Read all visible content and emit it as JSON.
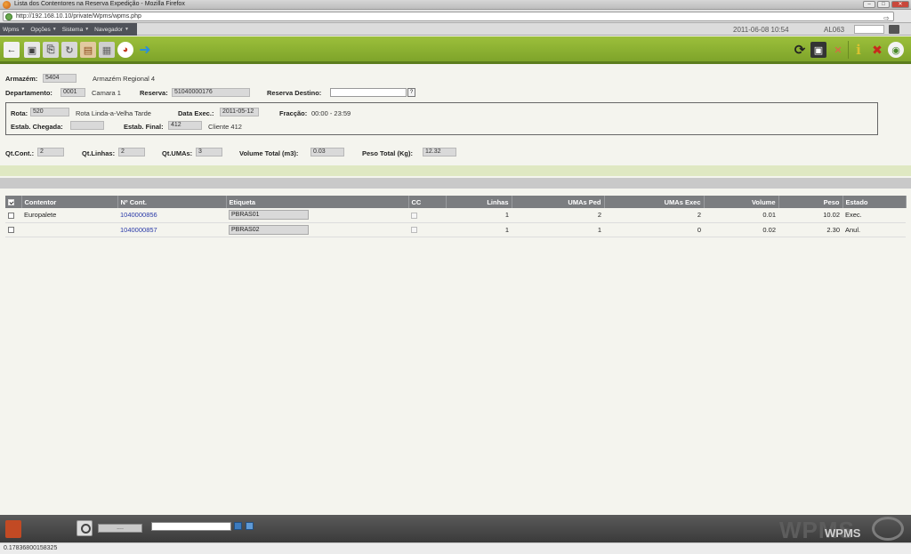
{
  "window": {
    "title": "Lista dos Contentores na Reserva Expedição - Mozilla Firefox"
  },
  "browser": {
    "url": "http://192.168.10.10/private/Wpms/wpms.php"
  },
  "menubar": {
    "menus": [
      {
        "label": "Wpms"
      },
      {
        "label": "Opções"
      },
      {
        "label": "Sistema"
      },
      {
        "label": "Navegador"
      }
    ],
    "datetime": "2011-06-08 10:54",
    "user": "AL063"
  },
  "header": {
    "armazem_label": "Armazém:",
    "armazem_code": "5404",
    "armazem_name": "Armazém Regional 4",
    "departamento_label": "Departamento:",
    "departamento_code": "0001",
    "departamento_name": "Camara 1",
    "reserva_label": "Reserva:",
    "reserva_value": "51040000176",
    "reserva_destino_label": "Reserva Destino:",
    "reserva_destino_value": "",
    "lookup_label": "?",
    "rota_label": "Rota:",
    "rota_code": "520",
    "rota_name": "Rota Linda-a-Velha Tarde",
    "data_exec_label": "Data Exec.:",
    "data_exec_value": "2011-05-12",
    "fraccao_label": "Fracção:",
    "fraccao_value": "00:00 - 23:59",
    "estab_chegada_label": "Estab. Chegada:",
    "estab_chegada_value": "",
    "estab_final_label": "Estab. Final:",
    "estab_final_code": "412",
    "estab_final_name": "Cliente 412"
  },
  "totals": {
    "qt_cont_label": "Qt.Cont.:",
    "qt_cont": "2",
    "qt_linhas_label": "Qt.Linhas:",
    "qt_linhas": "2",
    "qt_umas_label": "Qt.UMAs:",
    "qt_umas": "3",
    "volume_label": "Volume Total (m3):",
    "volume": "0.03",
    "peso_label": "Peso Total (Kg):",
    "peso": "12.32"
  },
  "table": {
    "columns": [
      "Contentor",
      "Nº Cont.",
      "Etiqueta",
      "CC",
      "Linhas",
      "UMAs Ped",
      "UMAs Exec",
      "Volume",
      "Peso",
      "Estado"
    ],
    "rows": [
      {
        "contentor": "Europalete",
        "num": "1040000856",
        "etiqueta": "PBRAS01",
        "linhas": "1",
        "umas_ped": "2",
        "umas_exec": "2",
        "volume": "0.01",
        "peso": "10.02",
        "estado": "Exec."
      },
      {
        "contentor": "",
        "num": "1040000857",
        "etiqueta": "PBRAS02",
        "linhas": "1",
        "umas_ped": "1",
        "umas_exec": "0",
        "volume": "0.02",
        "peso": "2.30",
        "estado": "Anul."
      }
    ]
  },
  "footer": {
    "more_label": "....",
    "logo": "WPMS",
    "logo_sub": "WPMS"
  },
  "status": {
    "text": "0.17836800158325"
  },
  "colors": {
    "toolbar_green": "#8db233",
    "header_gray": "#7b7d80",
    "link_blue": "#2a3aa8"
  },
  "toolbar_icons": [
    "back-arrow-icon",
    "save-icon",
    "refresh-doc-icon",
    "reload-doc-icon",
    "print-icon",
    "box-icon",
    "pie-chart-icon",
    "forward-arrow-icon",
    "refresh-icon",
    "export-icon",
    "expand-icon",
    "info-icon",
    "close-icon",
    "exit-icon"
  ]
}
